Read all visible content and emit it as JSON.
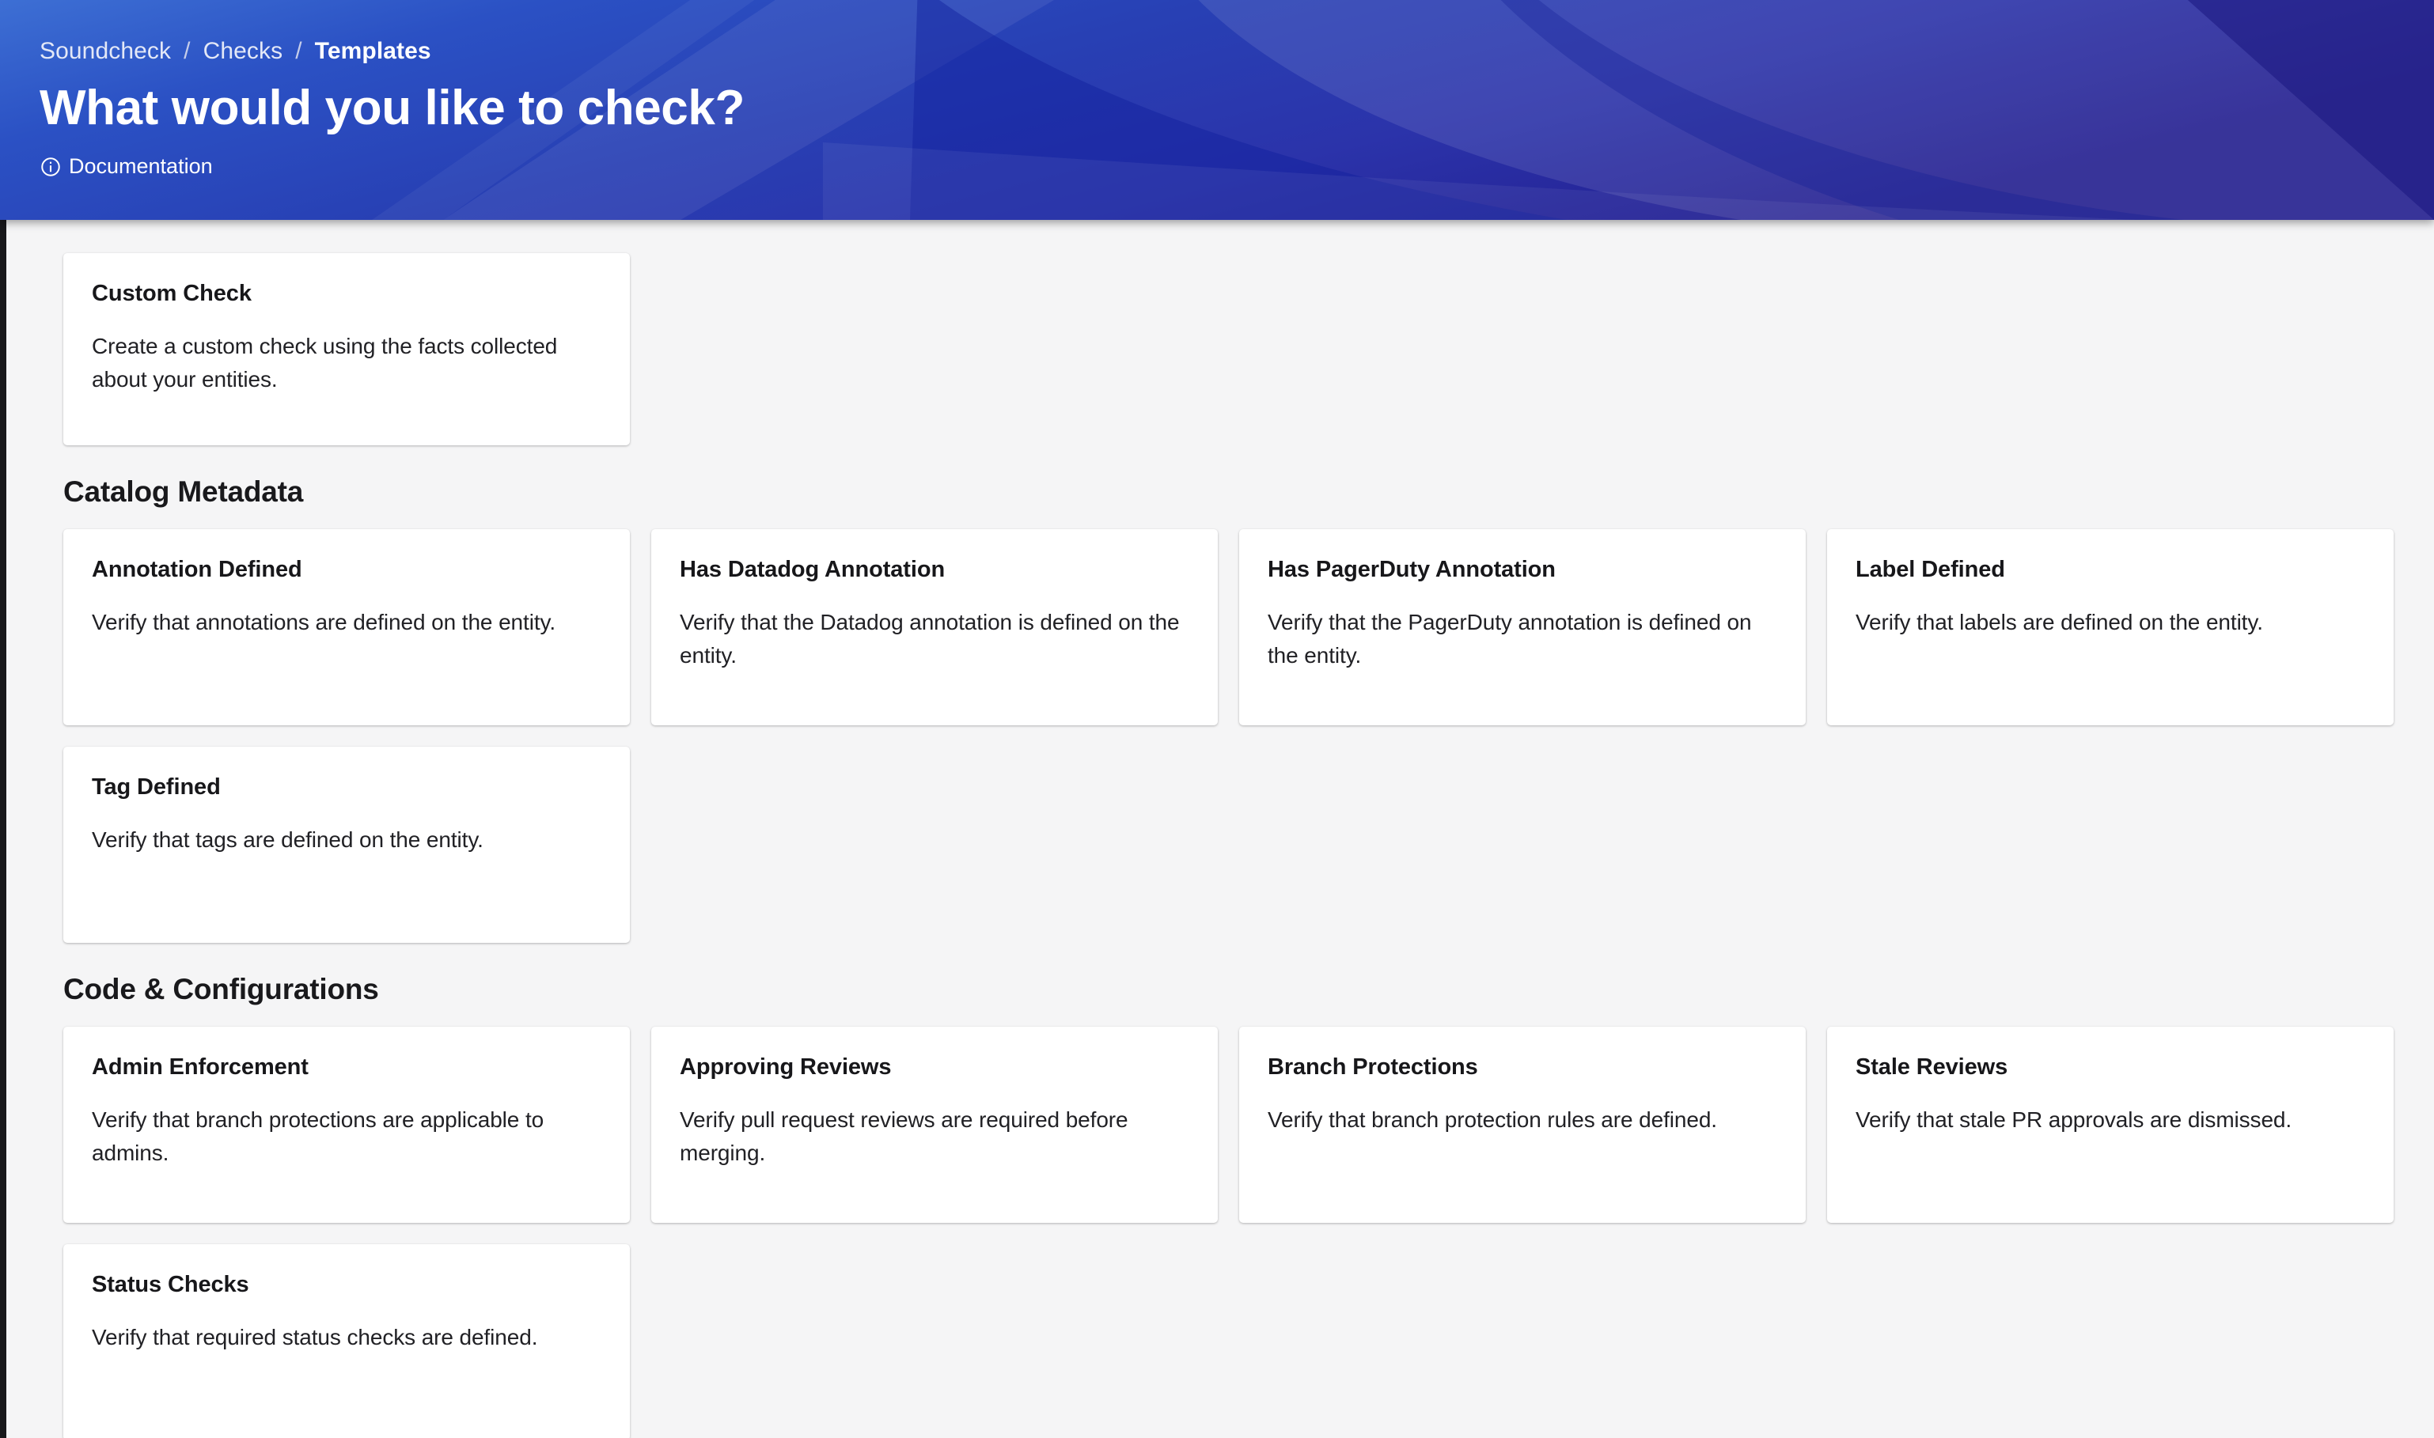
{
  "header": {
    "breadcrumb": [
      {
        "label": "Soundcheck",
        "current": false
      },
      {
        "label": "Checks",
        "current": false
      },
      {
        "label": "Templates",
        "current": true
      }
    ],
    "separator": "/",
    "title": "What would you like to check?",
    "documentation_label": "Documentation",
    "documentation_icon": "info-circle-icon",
    "gradient_from": "#3b6cd0",
    "gradient_to": "#242090"
  },
  "main": {
    "background": "#f5f5f6",
    "top_cards": [
      {
        "title": "Custom Check",
        "description": "Create a custom check using the facts collected about your entities."
      }
    ],
    "sections": [
      {
        "title": "Catalog Metadata",
        "cards": [
          {
            "title": "Annotation Defined",
            "description": "Verify that annotations are defined on the entity."
          },
          {
            "title": "Has Datadog Annotation",
            "description": "Verify that the Datadog annotation is defined on the entity."
          },
          {
            "title": "Has PagerDuty Annotation",
            "description": "Verify that the PagerDuty annotation is defined on the entity."
          },
          {
            "title": "Label Defined",
            "description": "Verify that labels are defined on the entity."
          },
          {
            "title": "Tag Defined",
            "description": "Verify that tags are defined on the entity."
          }
        ]
      },
      {
        "title": "Code & Configurations",
        "cards": [
          {
            "title": "Admin Enforcement",
            "description": "Verify that branch protections are applicable to admins."
          },
          {
            "title": "Approving Reviews",
            "description": "Verify pull request reviews are required before merging."
          },
          {
            "title": "Branch Protections",
            "description": "Verify that branch protection rules are defined."
          },
          {
            "title": "Stale Reviews",
            "description": "Verify that stale PR approvals are dismissed."
          },
          {
            "title": "Status Checks",
            "description": "Verify that required status checks are defined."
          }
        ]
      }
    ]
  }
}
